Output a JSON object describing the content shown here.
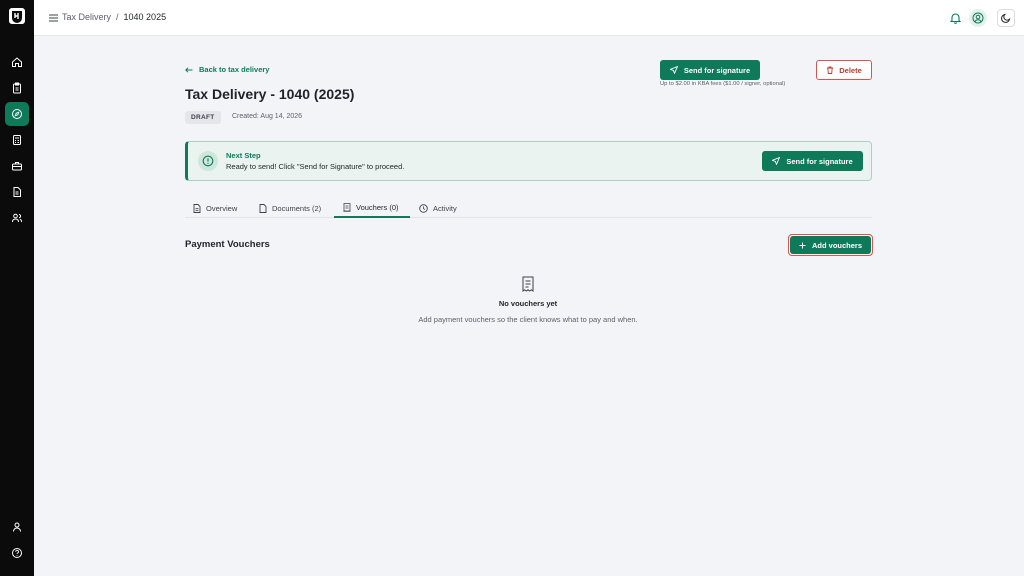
{
  "topbar": {
    "breadcrumb_root": "Tax Delivery",
    "breadcrumb_sep": "/",
    "breadcrumb_current": "1040 2025"
  },
  "header": {
    "back_link": "Back to tax delivery",
    "title": "Tax Delivery - 1040 (2025)",
    "status_badge": "DRAFT",
    "created": "Created: Aug 14, 2026",
    "send_button": "Send for signature",
    "kba_note": "Up to $2.00 in KBA fees ($1.00 / signer, optional)",
    "delete_button": "Delete"
  },
  "next_step": {
    "title": "Next Step",
    "message": "Ready to send! Click \"Send for Signature\" to proceed.",
    "button": "Send for signature"
  },
  "tabs": [
    {
      "label": "Overview",
      "icon": "document-icon",
      "active": false
    },
    {
      "label": "Documents (2)",
      "icon": "file-icon",
      "active": false
    },
    {
      "label": "Vouchers (0)",
      "icon": "receipt-icon",
      "active": true
    },
    {
      "label": "Activity",
      "icon": "clock-icon",
      "active": false
    }
  ],
  "vouchers": {
    "section_title": "Payment Vouchers",
    "add_button": "Add vouchers",
    "empty_title": "No vouchers yet",
    "empty_text": "Add payment vouchers so the client knows what to pay and when."
  },
  "sidebar": {
    "items": [
      "home-icon",
      "clipboard-icon",
      "compass-icon",
      "calculator-icon",
      "briefcase-icon",
      "document-icon",
      "users-icon"
    ],
    "active_index": 2,
    "bottom_items": [
      "user-icon",
      "help-icon"
    ]
  },
  "colors": {
    "accent": "#0f7a5a",
    "danger": "#d9534f",
    "rail": "#0b0b0c"
  }
}
